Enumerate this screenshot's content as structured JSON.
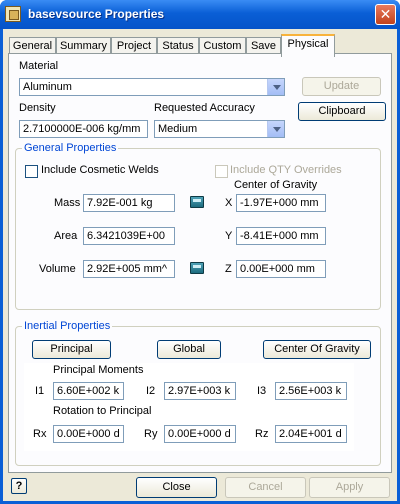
{
  "window": {
    "title": "basevsource Properties",
    "close": "✕"
  },
  "tabs": [
    "General",
    "Summary",
    "Project",
    "Status",
    "Custom",
    "Save",
    "Physical"
  ],
  "material": {
    "label": "Material",
    "value": "Aluminum"
  },
  "density": {
    "label": "Density",
    "value": "2.7100000E-006 kg/mm"
  },
  "accuracy": {
    "label": "Requested Accuracy",
    "value": "Medium"
  },
  "buttons": {
    "update": "Update",
    "clipboard": "Clipboard",
    "close": "Close",
    "cancel": "Cancel",
    "apply": "Apply",
    "help": "?"
  },
  "general": {
    "title": "General Properties",
    "cosmetic_welds": "Include Cosmetic Welds",
    "qty_overrides": "Include QTY Overrides",
    "cog_title": "Center of Gravity",
    "mass_label": "Mass",
    "mass_value": "7.92E-001 kg",
    "area_label": "Area",
    "area_value": "6.3421039E+00",
    "volume_label": "Volume",
    "volume_value": "2.92E+005 mm^",
    "x_label": "X",
    "x_value": "-1.97E+000 mm",
    "y_label": "Y",
    "y_value": "-8.41E+000 mm",
    "z_label": "Z",
    "z_value": "0.00E+000 mm"
  },
  "inertial": {
    "title": "Inertial Properties",
    "principal": "Principal",
    "global": "Global",
    "center_of_gravity": "Center Of Gravity",
    "moments_title": "Principal Moments",
    "i1_label": "I1",
    "i1_value": "6.60E+002 k",
    "i2_label": "I2",
    "i2_value": "2.97E+003 k",
    "i3_label": "I3",
    "i3_value": "2.56E+003 k",
    "rotation_title": "Rotation to Principal",
    "rx_label": "Rx",
    "rx_value": "0.00E+000 d",
    "ry_label": "Ry",
    "ry_value": "0.00E+000 d",
    "rz_label": "Rz",
    "rz_value": "2.04E+001 d"
  }
}
